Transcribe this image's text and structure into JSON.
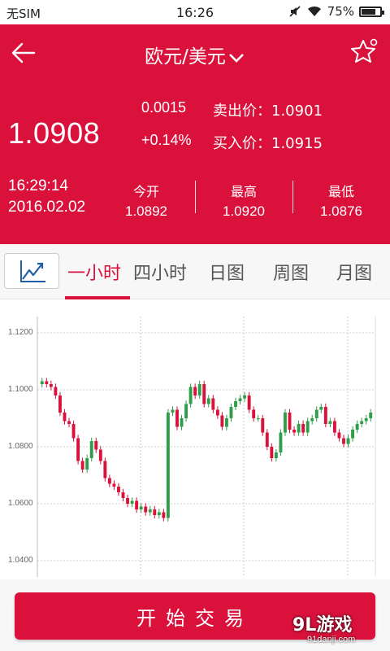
{
  "status_bar": {
    "carrier": "无SIM",
    "time": "16:26",
    "battery": "75%",
    "battery_level": 0.75
  },
  "header": {
    "title": "欧元/美元",
    "price": "1.0908",
    "change": "0.0015",
    "change_pct": "+0.14%",
    "sell_label": "卖出价：",
    "sell_value": "1.0901",
    "buy_label": "买入价：",
    "buy_value": "1.0915",
    "time": "16:29:14",
    "date": "2016.02.02",
    "open_label": "今开",
    "open_value": "1.0892",
    "high_label": "最高",
    "high_value": "1.0920",
    "low_label": "最低",
    "low_value": "1.0876"
  },
  "tabs": [
    {
      "label": "一小时",
      "active": true
    },
    {
      "label": "四小时",
      "active": false
    },
    {
      "label": "日图",
      "active": false
    },
    {
      "label": "周图",
      "active": false
    },
    {
      "label": "月图",
      "active": false
    }
  ],
  "chart_data": {
    "type": "candlestick",
    "ylim": [
      1.04,
      1.12
    ],
    "yticks": [
      "1.1200",
      "1.1000",
      "1.0800",
      "1.0600",
      "1.0400"
    ],
    "colors": {
      "up": "#2e9e48",
      "down": "#d9113b",
      "grid": "#cfcfcf"
    },
    "close": [
      1.103,
      1.102,
      1.101,
      1.098,
      1.092,
      1.089,
      1.088,
      1.083,
      1.075,
      1.072,
      1.076,
      1.082,
      1.079,
      1.075,
      1.069,
      1.067,
      1.066,
      1.064,
      1.062,
      1.06,
      1.061,
      1.058,
      1.059,
      1.057,
      1.058,
      1.056,
      1.057,
      1.055,
      1.092,
      1.093,
      1.087,
      1.09,
      1.095,
      1.101,
      1.098,
      1.102,
      1.095,
      1.097,
      1.093,
      1.091,
      1.087,
      1.09,
      1.094,
      1.096,
      1.097,
      1.098,
      1.093,
      1.09,
      1.09,
      1.085,
      1.08,
      1.076,
      1.078,
      1.085,
      1.092,
      1.086,
      1.085,
      1.088,
      1.085,
      1.089,
      1.09,
      1.093,
      1.094,
      1.088,
      1.089,
      1.085,
      1.083,
      1.081,
      1.083,
      1.086,
      1.088,
      1.089,
      1.09,
      1.092
    ]
  },
  "footer": {
    "trade_button": "开始交易",
    "watermark_brand": "9L游戏",
    "watermark_url": "91danji.com"
  }
}
